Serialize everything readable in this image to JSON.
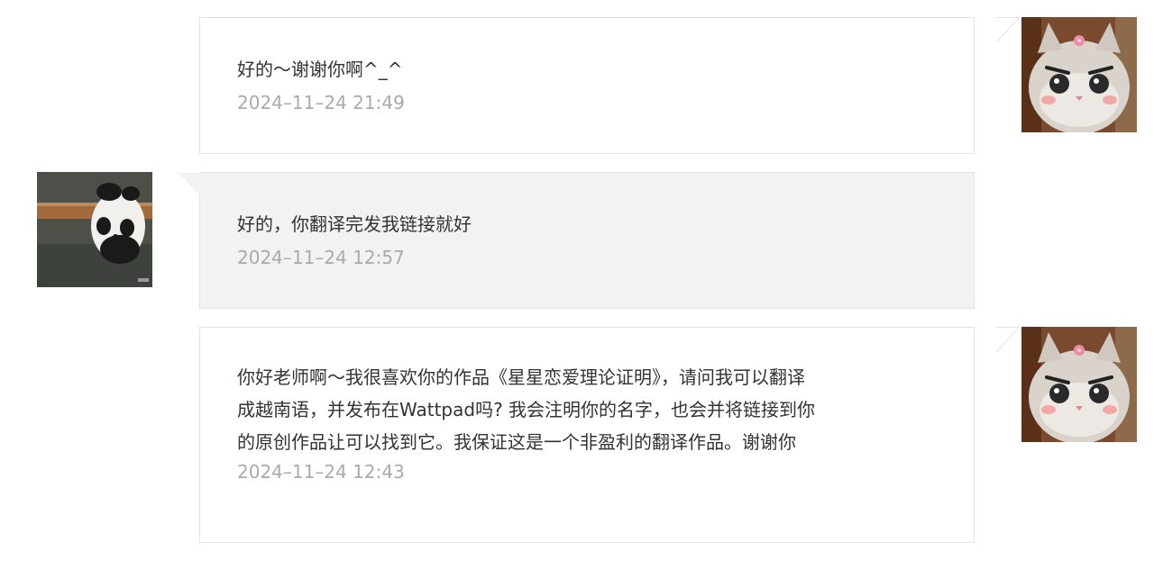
{
  "messages": [
    {
      "direction": "outgoing",
      "text": "好的～谢谢你啊^_^",
      "time": "2024–11–24 21:49",
      "avatar": "cat-avatar"
    },
    {
      "direction": "incoming",
      "text": "好的，你翻译完发我链接就好",
      "time": "2024–11–24 12:57",
      "avatar": "panda-avatar"
    },
    {
      "direction": "outgoing",
      "text": "你好老师啊～我很喜欢你的作品《星星恋爱理论证明》，请问我可以翻译\n成越南语，并发布在Wattpad吗? 我会注明你的名字，也会并将链接到你\n的原创作品让可以找到它。我保证这是一个非盈利的翻译作品。谢谢你",
      "time": "2024–11–24 12:43",
      "avatar": "cat-avatar"
    }
  ],
  "colors": {
    "outgoing_bg": "#ffffff",
    "incoming_bg": "#f2f2f2",
    "border": "#e3e3e3",
    "text": "#333333",
    "time": "#aaaaaa"
  }
}
